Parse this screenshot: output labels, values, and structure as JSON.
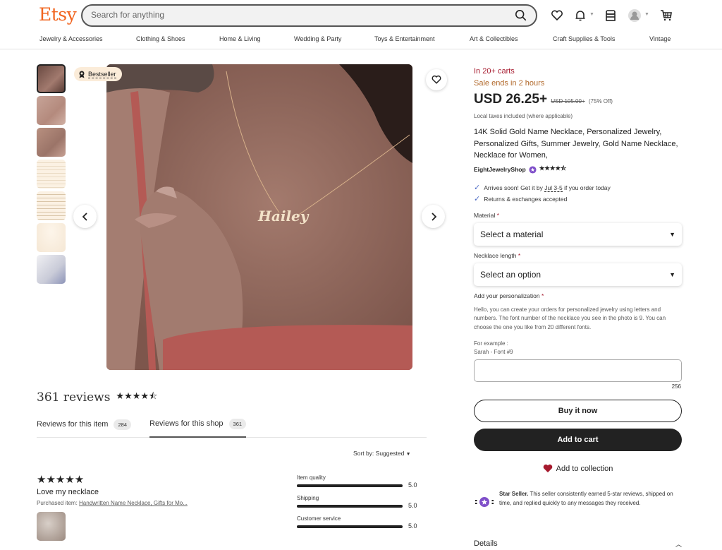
{
  "header": {
    "logo": "Etsy",
    "search_placeholder": "Search for anything",
    "icons": [
      "search-icon",
      "heart-icon",
      "bell-icon",
      "shop-icon",
      "avatar-icon",
      "cart-icon"
    ]
  },
  "nav": [
    "Jewelry & Accessories",
    "Clothing & Shoes",
    "Home & Living",
    "Wedding & Party",
    "Toys & Entertainment",
    "Art & Collectibles",
    "Craft Supplies & Tools",
    "Vintage"
  ],
  "gallery": {
    "badge": "Bestseller",
    "thumb_count": 7,
    "selected_index": 0,
    "main_image_caption": "Hailey"
  },
  "product": {
    "in_carts": "In 20+ carts",
    "sale_ends": "Sale ends in 2 hours",
    "price": "USD 26.25+",
    "original_price": "USD 105.00+",
    "discount": "(75% Off)",
    "tax_note": "Local taxes included (where applicable)",
    "title": "14K Solid Gold Name Necklace, Personalized Jewelry, Personalized Gifts, Summer Jewelry, Gold Name Necklace, Necklace for Women,",
    "shop_name": "EightJewelryShop",
    "shop_rating": 4.5,
    "shop_stars": "★★★★⯪",
    "arrives_prefix": "Arrives soon! Get it by ",
    "arrives_date": "Jul 3-5",
    "arrives_suffix": " if you order today",
    "returns": "Returns & exchanges accepted",
    "material_label": "Material",
    "material_value": "Select a material",
    "length_label": "Necklace length",
    "length_value": "Select an option",
    "personalization_label": "Add your personalization",
    "personalization_desc": "Hello, you can create your orders for personalized jewelry using letters and numbers. The font number of the necklace you see in the photo is 9. You can choose the one you like from 20 different fonts.",
    "example_label": "For example :",
    "example_value": "Sarah - Font #9",
    "personalization_value": "",
    "char_count": "256",
    "buy_now": "Buy it now",
    "add_to_cart": "Add to cart",
    "add_to_collection": "Add to collection",
    "star_seller_title": "Star Seller.",
    "star_seller_text": " This seller consistently earned 5-star reviews, shipped on time, and replied quickly to any messages they received.",
    "details": "Details"
  },
  "reviews": {
    "title": "361 reviews",
    "rating": 4.5,
    "stars": "★★★★⯪",
    "tabs": [
      {
        "label": "Reviews for this item",
        "count": "284"
      },
      {
        "label": "Reviews for this shop",
        "count": "361",
        "active": true
      }
    ],
    "sort": "Sort by: Suggested",
    "items": [
      {
        "stars": "★★★★★",
        "rating": 5,
        "text": "Love my necklace",
        "purchased_label": "Purchased item: ",
        "purchased_item": "Handwritten Name Necklace, Gifts for Mo..."
      }
    ],
    "breakdown": [
      {
        "label": "Item quality",
        "value": "5.0",
        "fraction": 1.0
      },
      {
        "label": "Shipping",
        "value": "5.0",
        "fraction": 1.0
      },
      {
        "label": "Customer service",
        "value": "5.0",
        "fraction": 1.0
      }
    ]
  },
  "colors": {
    "brand": "#f1641e",
    "in_carts": "#a61a2e",
    "sale": "#b1682a",
    "star_seller": "#7f4fc9",
    "check": "#4d6bc6"
  }
}
